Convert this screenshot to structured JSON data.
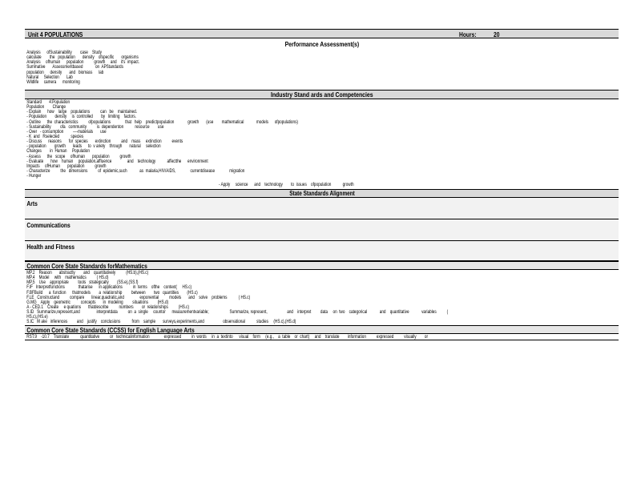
{
  "unit": {
    "title": "Unit    4   POPULATIONS",
    "hours_label": "Hours:",
    "hours_value": "20"
  },
  "performance": {
    "header": "Performance        Assessment(s)",
    "lines": [
      "Analysis      ofSustainability        case    Study",
      "calculate        the   population       density    ofspecific       organisms",
      "Analysis     ofhuman      population          growth     and    it's  impact.",
      "Summative       Assessmentbased            on  APStandards",
      "population      density       and   biomass      lab",
      "Natural     Selection       Lab",
      "Wildlife     camera      monitoring"
    ]
  },
  "industry": {
    "header": "Industry      Stand    ards    and    Competencies",
    "lines": [
      "Standard       4:Population",
      "Population        Change",
      "- Explain      how    large    populations          can   be    maintained.",
      "- Population        density     is  controlled        by   limiting    factors.",
      "- Outline      the  characteristics          ofpopulations              that   help    predictpopulation             growth       (use        mathematical            models      ofpopulations)",
      "- Sustainability         ofa   community          is  dependenton           resource        use",
      "- Over   - consumption         ----materials       use",
      "- K  and   Rselected           species",
      "- Discuss      reasons       for  species       extinction          and    mass     extinction          events",
      "- population        growth       leads      to  v ariety    through       natural     selection",
      "Changes        in  Human     Population",
      "- Assess      the   scope     ofhuman       population          growth",
      "- Evaluate       how    human     population,affluence               and    technology           affectthe      environment",
      "Impacts     ofHuman       population          growth",
      "- Characterize          the   dimensions          of  epidemic,such            as  malaria,HIV/AIDS,              currentdisease              migration",
      "- Hunger"
    ],
    "closing": "- Apply     science      and    technology        to  issues    ofpopulation           growth"
  },
  "state": {
    "header": "State Standards          Alignment"
  },
  "sections": {
    "arts": "Arts",
    "communications": "Communications",
    "health": "Health      and     Fitness"
  },
  "math": {
    "header": "Common       Core      State      Standards       forMathematics",
    "lines": [
      "MP.2    Reason       abstractly        and    quantitatively          (HS.b),(HS.c)",
      "MP.4    Model     with    mathematics          ( HS.d)",
      "MP.5    Use    appropriate         tools   strategically        (SS.e),(SS.f)",
      "F.IF   Interpretfunctions             thatarise      in applications          in  terms    ofthe    context(     HS.c)",
      "F.BFBuild      a  function      thatmodels        a  relationship         between        two   quantities        (HS.c)",
      "F.LE   Constructand          compare       linear,quadratic,and               exponential          models       and    solve    problems           ( HS.c)",
      "G.MG    Apply    geometric          concepts       in  modeling         situations         (HS.d)",
      "A - CED.1    Create     e quations       thatdescribe          numbers        or  relationships          (HS.c)",
      "S.ID   Summarize,represent,and                interpretdata          on  a  single     countor      measurementvariable;                    Summarize, represent,                   and    interpret         data     on  two    categorical            and    quantitative            variables          (",
      "HS.c),(HS.e)",
      "S.IC   M ake   inferences         and    justify    conclusions           from    sample       surveys,experiments,and                  observational           studies     (HS.c),(HS.d)"
    ]
  },
  "english": {
    "header": "Common       Core      State      Standards         (CCSS)      for    English       Language        Arts",
    "lines": [
      "RST.9    -10.7    Translate           quantitative          or   technicalinformation              expressed          in  words     in  a  textinto      visual    form     (e.g.,    a  table    or  chart)     and    translate        information          expressed          visually        or"
    ]
  }
}
